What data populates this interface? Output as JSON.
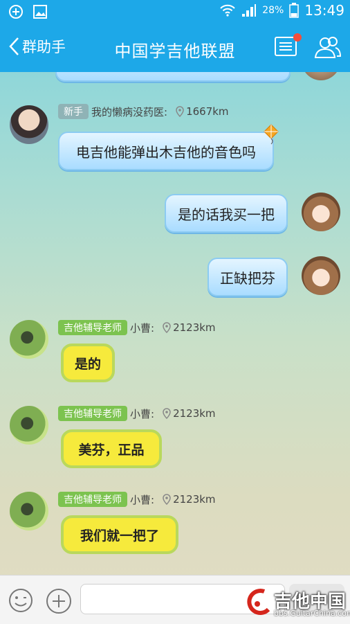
{
  "status_bar": {
    "battery_pct": "28%",
    "time": "13:49"
  },
  "header": {
    "back_label": "群助手",
    "title": "中国学吉他联盟"
  },
  "messages": [
    {
      "tag": "新手",
      "sender": "我的懒病没药医:",
      "distance": "1667km",
      "text": "电吉他能弹出木吉他的音色吗"
    },
    {
      "text": "是的话我买一把"
    },
    {
      "text": "正缺把芬"
    },
    {
      "tag": "吉他辅导老师",
      "sender": "小曹:",
      "distance": "2123km",
      "text": "是的"
    },
    {
      "tag": "吉他辅导老师",
      "sender": "小曹:",
      "distance": "2123km",
      "text": "美芬，正品"
    },
    {
      "tag": "吉他辅导老师",
      "sender": "小曹:",
      "distance": "2123km",
      "text": "我们就一把了"
    }
  ],
  "input": {
    "value": ""
  },
  "watermark": {
    "title": "吉他中国",
    "url": "bbs.GuitarChina.com"
  },
  "colors": {
    "header": "#1da8e8",
    "badge": "#f24e3b",
    "tag_teacher": "#7cc34f",
    "tag_newbie": "#8fb3b6",
    "lemon": "#f6ea3c"
  }
}
